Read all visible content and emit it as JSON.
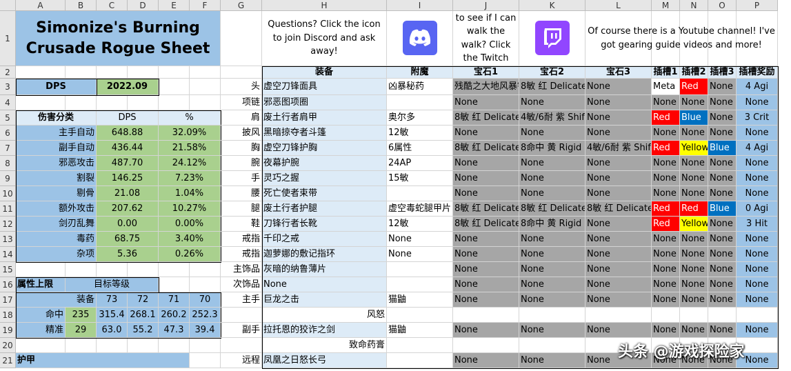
{
  "col_headers": [
    "A",
    "B",
    "C",
    "D",
    "E",
    "F",
    "G",
    "H",
    "I",
    "J",
    "K",
    "L",
    "M",
    "N",
    "O",
    "P"
  ],
  "row_numbers": [
    "1",
    "2",
    "3",
    "4",
    "5",
    "6",
    "7",
    "8",
    "9",
    "10",
    "11",
    "12",
    "13",
    "14",
    "15",
    "16",
    "17",
    "18",
    "19",
    "20",
    "21"
  ],
  "title": "Simonize's Burning Crusade Rogue Sheet",
  "notes": {
    "discord": "Questions? Click the icon to join Discord and ask away!",
    "twitch": "I can talk the talk, but want to see if I can walk the walk? Click the Twitch icon to see me live!",
    "youtube": "Of course there is a Youtube channel! I've got gearing guide videos and more!"
  },
  "dps": {
    "label": "DPS",
    "value": "2022.09"
  },
  "damage": {
    "header": "伤害分类",
    "col_dps": "DPS",
    "col_pct": "%",
    "rows": [
      {
        "name": "主手自动",
        "dps": "648.88",
        "pct": "32.09%"
      },
      {
        "name": "副手自动",
        "dps": "436.44",
        "pct": "21.58%"
      },
      {
        "name": "邪恶攻击",
        "dps": "487.70",
        "pct": "24.12%"
      },
      {
        "name": "割裂",
        "dps": "146.25",
        "pct": "7.23%"
      },
      {
        "name": "剔骨",
        "dps": "21.08",
        "pct": "1.04%"
      },
      {
        "name": "额外攻击",
        "dps": "207.62",
        "pct": "10.27%"
      },
      {
        "name": "剑刃乱舞",
        "dps": "0.00",
        "pct": "0.00%"
      },
      {
        "name": "毒药",
        "dps": "68.75",
        "pct": "3.40%"
      },
      {
        "name": "杂项",
        "dps": "5.36",
        "pct": "0.26%"
      }
    ]
  },
  "caps": {
    "header": "属性上限",
    "target": "目标等级",
    "gear": "装备",
    "levels": [
      "73",
      "72",
      "71",
      "70"
    ],
    "rows": [
      {
        "name": "命中",
        "gear": "235",
        "vals": [
          "315.4",
          "268.1",
          "260.2",
          "252.3"
        ]
      },
      {
        "name": "精准",
        "gear": "29",
        "vals": [
          "63.0",
          "55.2",
          "47.3",
          "39.4"
        ]
      }
    ]
  },
  "armor_label": "护甲",
  "gear": {
    "headers": {
      "item": "装备",
      "enchant": "附魔",
      "gem1": "宝石1",
      "gem2": "宝石2",
      "gem3": "宝石3",
      "s1": "插槽1",
      "s2": "插槽2",
      "s3": "插槽3",
      "bonus": "插槽奖励"
    },
    "rows": [
      {
        "slot": "头",
        "item": "虚空刀锋面具",
        "enchant": "凶暴秘药",
        "gem1": "残酷之大地风暴钻石",
        "gem2": "8敏 红 Delicate",
        "gem3": "None",
        "s1": "Meta",
        "s2": "Red",
        "s3": "None",
        "bonus": "4 Agi"
      },
      {
        "slot": "项链",
        "item": "邪恶图项圈",
        "enchant": "",
        "gem1": "None",
        "gem2": "None",
        "gem3": "None",
        "s1": "None",
        "s2": "None",
        "s3": "None",
        "bonus": "None"
      },
      {
        "slot": "肩",
        "item": "废土行者肩甲",
        "enchant": "奥尔多",
        "gem1": "8敏 红 Delicate",
        "gem2": "4敏/6耐 紫 Shifting",
        "gem3": "None",
        "s1": "Red",
        "s2": "Blue",
        "s3": "None",
        "bonus": "3 Crit"
      },
      {
        "slot": "披风",
        "item": "黑暗掠夺者斗篷",
        "enchant": "12敏",
        "gem1": "None",
        "gem2": "None",
        "gem3": "None",
        "s1": "None",
        "s2": "None",
        "s3": "None",
        "bonus": "None"
      },
      {
        "slot": "胸",
        "item": "虚空刀锋护胸",
        "enchant": "6属性",
        "gem1": "8敏 红 Delicate",
        "gem2": "8命中 黄 Rigid Dawnstone",
        "gem3": "4敏/6耐 紫 Shifting",
        "s1": "Red",
        "s2": "Yellow",
        "s3": "Blue",
        "bonus": "4 Agi"
      },
      {
        "slot": "腕",
        "item": "夜幕护腕",
        "enchant": "24AP",
        "gem1": "None",
        "gem2": "None",
        "gem3": "None",
        "s1": "None",
        "s2": "None",
        "s3": "None",
        "bonus": "None"
      },
      {
        "slot": "手",
        "item": "灵巧之握",
        "enchant": "15敏",
        "gem1": "None",
        "gem2": "None",
        "gem3": "None",
        "s1": "None",
        "s2": "None",
        "s3": "None",
        "bonus": "None"
      },
      {
        "slot": "腰",
        "item": "死亡使者束带",
        "enchant": "",
        "gem1": "None",
        "gem2": "None",
        "gem3": "None",
        "s1": "None",
        "s2": "None",
        "s3": "None",
        "bonus": "None"
      },
      {
        "slot": "腿",
        "item": "废土行者护腿",
        "enchant": "虚空毒蛇腿甲片",
        "gem1": "8敏 红 Delicate",
        "gem2": "8敏 红 Delicate",
        "gem3": "8敏 红 Delicate",
        "s1": "Red",
        "s2": "Red",
        "s3": "Blue",
        "bonus": "0 Agi"
      },
      {
        "slot": "鞋",
        "item": "刀锋行者长靴",
        "enchant": "12敏",
        "gem1": "8敏 红 Delicate",
        "gem2": "8命中 黄 Rigid Dawnstone",
        "gem3": "None",
        "s1": "Red",
        "s2": "Yellow",
        "s3": "None",
        "bonus": "3 Hit"
      },
      {
        "slot": "戒指",
        "item": "千印之戒",
        "enchant": "None",
        "gem1": "None",
        "gem2": "None",
        "gem3": "None",
        "s1": "None",
        "s2": "None",
        "s3": "None",
        "bonus": "None"
      },
      {
        "slot": "戒指",
        "item": "迦萝娜的敷记指环",
        "enchant": "None",
        "gem1": "None",
        "gem2": "None",
        "gem3": "None",
        "s1": "None",
        "s2": "None",
        "s3": "None",
        "bonus": "None"
      },
      {
        "slot": "主饰品",
        "item": "灰暗的纳鲁薄片",
        "enchant": "",
        "gem1": "None",
        "gem2": "None",
        "gem3": "None",
        "s1": "None",
        "s2": "None",
        "s3": "None",
        "bonus": "None"
      },
      {
        "slot": "次饰品",
        "item": "None",
        "enchant": "",
        "gem1": "None",
        "gem2": "None",
        "gem3": "None",
        "s1": "None",
        "s2": "None",
        "s3": "None",
        "bonus": "None"
      },
      {
        "slot": "主手",
        "item": "巨龙之击",
        "enchant": "猫鼬",
        "gem1": "None",
        "gem2": "None",
        "gem3": "None",
        "s1": "None",
        "s2": "None",
        "s3": "None",
        "bonus": "None"
      },
      {
        "slot": "",
        "item": "风怒",
        "enchant": null,
        "gem1": null,
        "gem2": null,
        "gem3": null,
        "s1": null,
        "s2": null,
        "s3": null,
        "bonus": null
      },
      {
        "slot": "副手",
        "item": "拉托恩的狡诈之剑",
        "enchant": "猫鼬",
        "gem1": "None",
        "gem2": "None",
        "gem3": "None",
        "s1": "None",
        "s2": "None",
        "s3": "None",
        "bonus": "None"
      },
      {
        "slot": "",
        "item": "致命药膏",
        "enchant": null,
        "gem1": null,
        "gem2": null,
        "gem3": null,
        "s1": null,
        "s2": null,
        "s3": null,
        "bonus": null
      },
      {
        "slot": "远程",
        "item": "凤凰之日怒长弓",
        "enchant": "",
        "gem1": "None",
        "gem2": "None",
        "gem3": "None",
        "s1": "None",
        "s2": "None",
        "s3": "None",
        "bonus": "None"
      }
    ]
  },
  "icons": {
    "discord": "discord-icon",
    "twitch": "twitch-icon"
  },
  "colors": {
    "blue": "#9cc3e6",
    "light_blue": "#ddebf7",
    "green": "#a9d08e",
    "gray": "#a6a6a6",
    "red": "#ff0000",
    "yellow": "#ffff00",
    "socket_blue": "#0070c0",
    "discord": "#5865f2",
    "twitch": "#9146ff"
  },
  "watermark": "头条 @游戏探险家"
}
